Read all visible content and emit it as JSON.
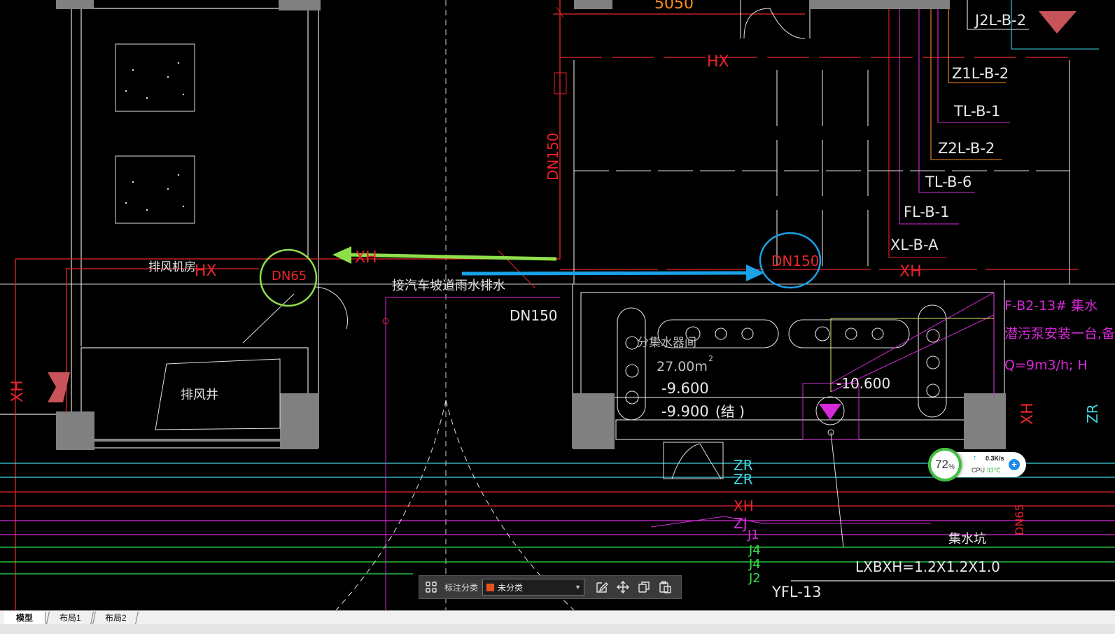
{
  "drawing": {
    "top_dimension": "5050",
    "labels": {
      "hx_top": "HX",
      "hx_left": "HX",
      "xh_top_right": "XH",
      "xh_left_vertical": "XH",
      "xh_right_vertical": "XH",
      "dn150_vertical": "DN150",
      "dn150_below": "DN150",
      "dn150_circle": "DN150",
      "dn65_circle": "DN65",
      "dn65_right": "DN65",
      "exhaust_room": "排风机房",
      "exhaust_shaft": "排风井",
      "ramp_note": "接汽车坡道雨水排水",
      "collection_room": "分集水器间",
      "area": "27.00m",
      "area_sup": "2",
      "elev1": "-9.600",
      "elev2": "-9.900",
      "elev2_suffix": "(结 )",
      "elev3": "-10.600",
      "sump": "集水坑",
      "sump_dim": "LXBXH=1.2X1.2X1.0",
      "yfl": "YFL-13",
      "zr1": "ZR",
      "zr2": "ZR",
      "xh_bottom": "XH",
      "zj": "ZJ",
      "j1": "J1",
      "j4a": "J4",
      "j4b": "J4",
      "j2": "J2",
      "pump_note1": "F-B2-13# 集水",
      "pump_note2": "潜污泵安装一台,备用",
      "pump_note3": "Q=9m3/h;  H",
      "zr_right": "ZR"
    },
    "pipe_tags": [
      "J2L-B-2",
      "Z1L-B-2",
      "TL-B-1",
      "Z2L-B-2",
      "TL-B-6",
      "FL-B-1",
      "XL-B-A"
    ]
  },
  "annotation_toolbar": {
    "category_label": "标注分类",
    "selected_category": "未分类",
    "swatch_color": "#e8521e"
  },
  "layout_tabs": [
    {
      "label": "模型",
      "active": true
    },
    {
      "label": "布局1",
      "active": false
    },
    {
      "label": "布局2",
      "active": false
    }
  ],
  "system_monitor": {
    "percent": "72",
    "percent_sign": "%",
    "net_speed": "0.3K/s",
    "cpu_label": "CPU",
    "cpu_temp": "33℃"
  },
  "colors": {
    "red": "#e8252a",
    "white": "#e8e8e8",
    "cyan": "#3fd7e0",
    "green": "#2fe34a",
    "magenta": "#d62ad8",
    "orange": "#ff8c1a",
    "arrow_green": "#8ee04a",
    "arrow_blue": "#1aa1e8"
  }
}
